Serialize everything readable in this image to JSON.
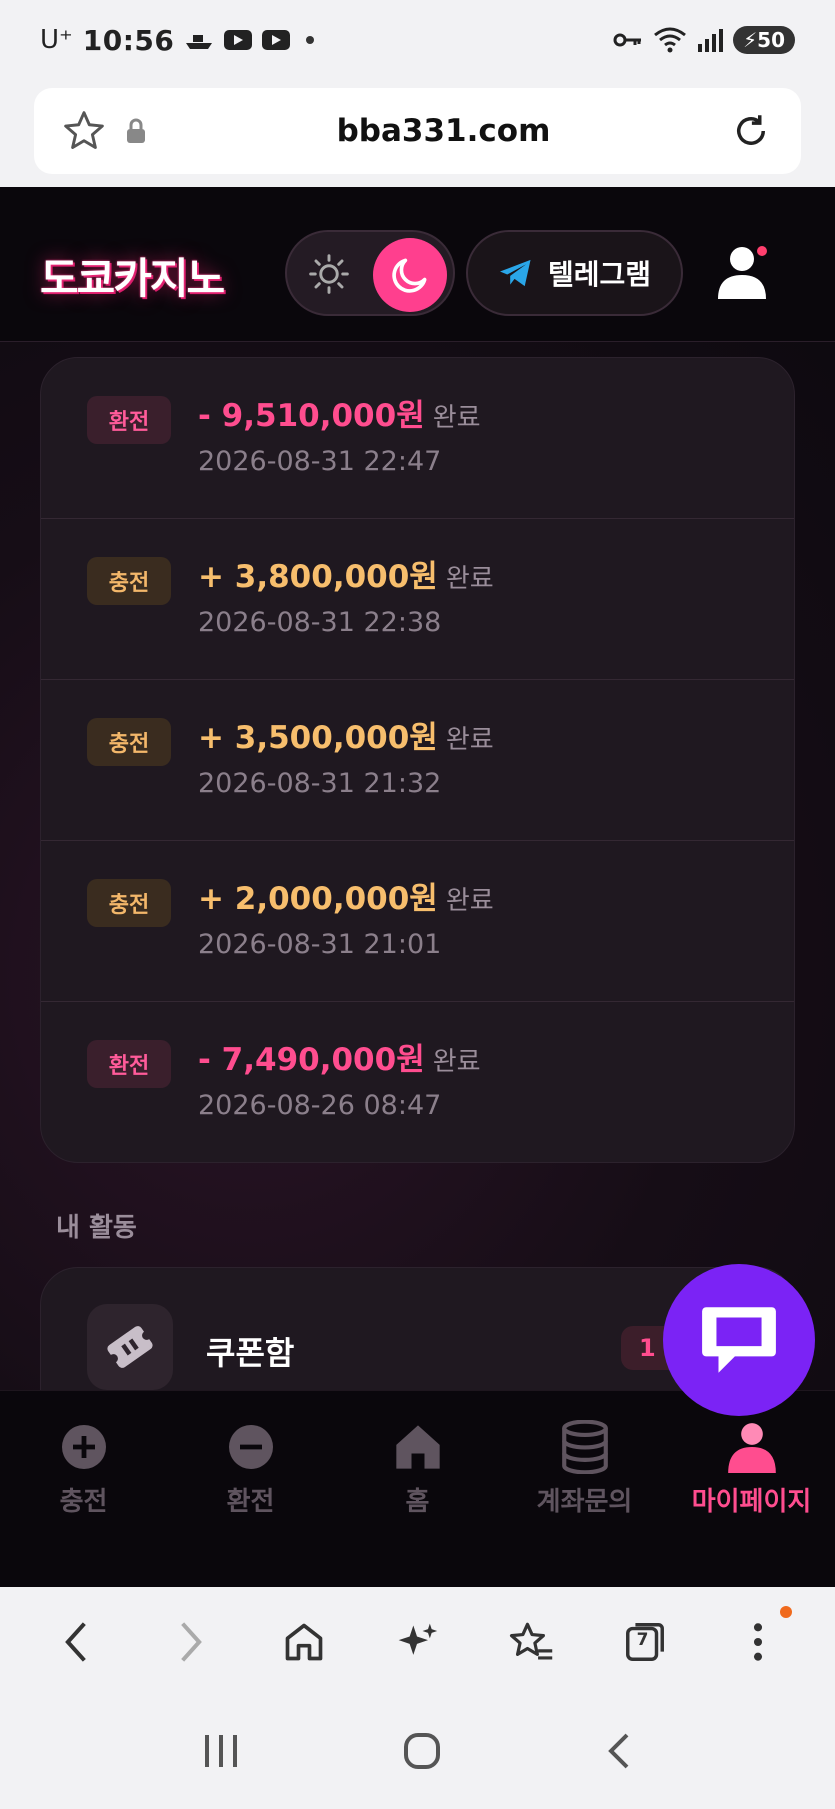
{
  "status_bar": {
    "carrier": "U⁺",
    "time": "10:56",
    "battery": "50"
  },
  "browser": {
    "url": "bba331.com"
  },
  "header": {
    "logo": "도쿄카지노",
    "telegram_label": "텔레그램"
  },
  "transactions": [
    {
      "type": "환전",
      "kind": "out",
      "amount": "- 9,510,000원",
      "status": "완료",
      "datetime": "2026-08-31 22:47"
    },
    {
      "type": "충전",
      "kind": "in",
      "amount": "+ 3,800,000원",
      "status": "완료",
      "datetime": "2026-08-31 22:38"
    },
    {
      "type": "충전",
      "kind": "in",
      "amount": "+ 3,500,000원",
      "status": "완료",
      "datetime": "2026-08-31 21:32"
    },
    {
      "type": "충전",
      "kind": "in",
      "amount": "+ 2,000,000원",
      "status": "완료",
      "datetime": "2026-08-31 21:01"
    },
    {
      "type": "환전",
      "kind": "out",
      "amount": "- 7,490,000원",
      "status": "완료",
      "datetime": "2026-08-26 08:47"
    }
  ],
  "activity": {
    "section_label": "내 활동",
    "coupon_label": "쿠폰함",
    "coupon_count": "1"
  },
  "tabbar": [
    {
      "label": "충전",
      "icon": "plus-circle-icon"
    },
    {
      "label": "환전",
      "icon": "minus-circle-icon"
    },
    {
      "label": "홈",
      "icon": "home-icon"
    },
    {
      "label": "계좌문의",
      "icon": "database-icon"
    },
    {
      "label": "마이페이지",
      "icon": "user-icon",
      "active": true
    }
  ],
  "browser_toolbar": {
    "tabs_count": "7"
  },
  "colors": {
    "accent": "#ff4d8f",
    "deposit": "#f7be6d",
    "chat": "#7b23f5",
    "background": "#0f0b12"
  }
}
